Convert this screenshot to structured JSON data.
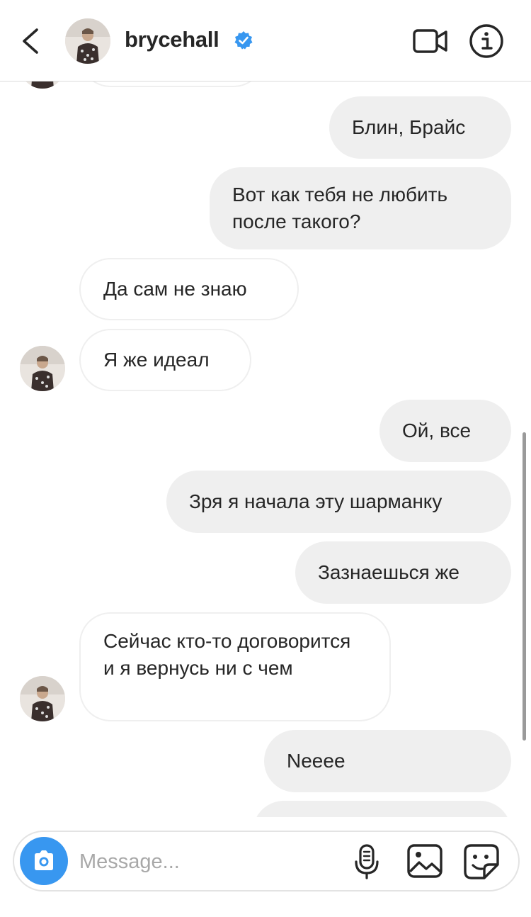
{
  "header": {
    "username": "brycehall",
    "verified": true
  },
  "messages": [
    {
      "from": "me",
      "text": "Блин, Брайс"
    },
    {
      "from": "me",
      "text": "Вот как тебя не любить после такого?"
    },
    {
      "from": "them",
      "text": "Да сам не знаю"
    },
    {
      "from": "them",
      "text": "Я же идеал"
    },
    {
      "from": "me",
      "text": "Ой, все"
    },
    {
      "from": "me",
      "text": "Зря я начала эту шарманку"
    },
    {
      "from": "me",
      "text": "Зазнаешься же"
    },
    {
      "from": "them",
      "text": "Сейчас кто-то договорится и я вернусь ни с чем"
    },
    {
      "from": "me",
      "text": "Neeee"
    }
  ],
  "composer": {
    "placeholder": "Message..."
  },
  "colors": {
    "accent": "#3897f0",
    "outgoing_bubble": "#efefef",
    "incoming_border": "#efefef"
  },
  "icons": [
    "back-chevron-icon",
    "verified-badge-icon",
    "video-call-icon",
    "info-icon",
    "camera-icon",
    "microphone-icon",
    "gallery-icon",
    "sticker-icon"
  ]
}
